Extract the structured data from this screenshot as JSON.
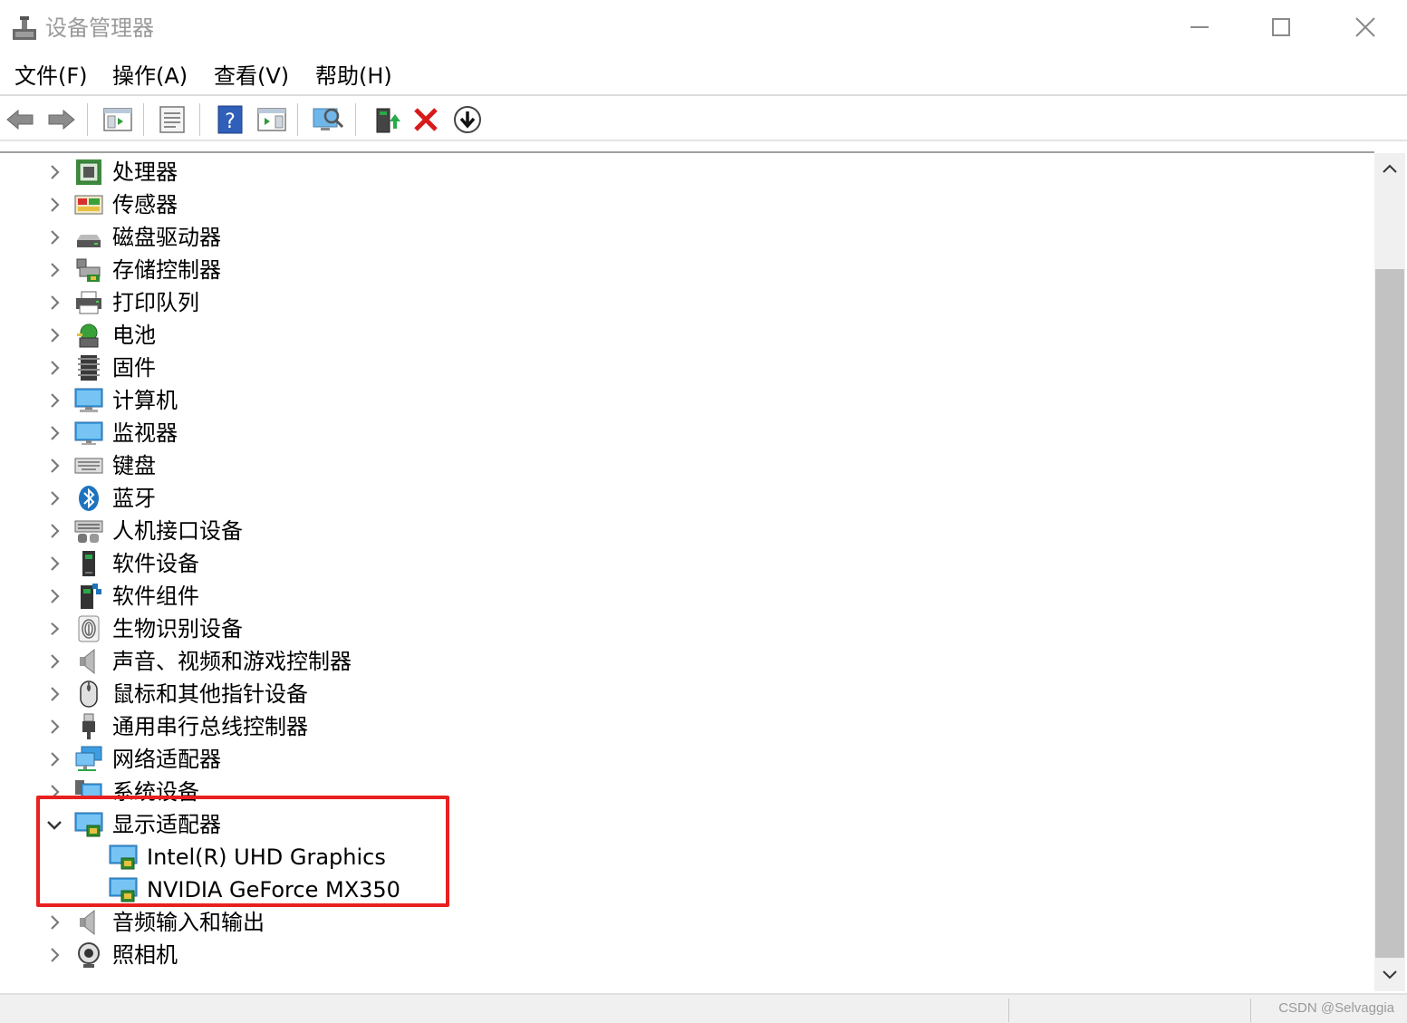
{
  "window": {
    "title": "设备管理器"
  },
  "menu": [
    {
      "label": "文件(F)"
    },
    {
      "label": "操作(A)"
    },
    {
      "label": "查看(V)"
    },
    {
      "label": "帮助(H)"
    }
  ],
  "toolbar": {
    "icons": [
      "back-icon",
      "forward-icon",
      "show-hide-console-tree-icon",
      "properties-icon",
      "help-icon",
      "action-pane-icon",
      "scan-hardware-icon",
      "update-driver-icon",
      "uninstall-device-icon",
      "download-driver-icon"
    ]
  },
  "tree": {
    "items": [
      {
        "label": "处理器",
        "icon": "processor-icon",
        "expanded": false
      },
      {
        "label": "传感器",
        "icon": "sensor-icon",
        "expanded": false
      },
      {
        "label": "磁盘驱动器",
        "icon": "disk-drive-icon",
        "expanded": false
      },
      {
        "label": "存储控制器",
        "icon": "storage-controller-icon",
        "expanded": false
      },
      {
        "label": "打印队列",
        "icon": "printer-icon",
        "expanded": false
      },
      {
        "label": "电池",
        "icon": "battery-icon",
        "expanded": false
      },
      {
        "label": "固件",
        "icon": "firmware-icon",
        "expanded": false
      },
      {
        "label": "计算机",
        "icon": "computer-icon",
        "expanded": false
      },
      {
        "label": "监视器",
        "icon": "monitor-icon",
        "expanded": false
      },
      {
        "label": "键盘",
        "icon": "keyboard-icon",
        "expanded": false
      },
      {
        "label": "蓝牙",
        "icon": "bluetooth-icon",
        "expanded": false
      },
      {
        "label": "人机接口设备",
        "icon": "hid-icon",
        "expanded": false
      },
      {
        "label": "软件设备",
        "icon": "software-device-icon",
        "expanded": false
      },
      {
        "label": "软件组件",
        "icon": "software-component-icon",
        "expanded": false
      },
      {
        "label": "生物识别设备",
        "icon": "biometric-icon",
        "expanded": false
      },
      {
        "label": "声音、视频和游戏控制器",
        "icon": "sound-icon",
        "expanded": false
      },
      {
        "label": "鼠标和其他指针设备",
        "icon": "mouse-icon",
        "expanded": false
      },
      {
        "label": "通用串行总线控制器",
        "icon": "usb-icon",
        "expanded": false
      },
      {
        "label": "网络适配器",
        "icon": "network-adapter-icon",
        "expanded": false
      },
      {
        "label": "系统设备",
        "icon": "system-device-icon",
        "expanded": false
      },
      {
        "label": "显示适配器",
        "icon": "display-adapter-icon",
        "expanded": true,
        "children": [
          {
            "label": "Intel(R) UHD Graphics",
            "icon": "display-adapter-icon"
          },
          {
            "label": "NVIDIA GeForce MX350",
            "icon": "display-adapter-icon"
          }
        ]
      },
      {
        "label": "音频输入和输出",
        "icon": "audio-io-icon",
        "expanded": false
      },
      {
        "label": "照相机",
        "icon": "camera-icon",
        "expanded": false
      }
    ]
  },
  "status": {
    "watermark": "CSDN @Selvaggia"
  },
  "colors": {
    "highlight": "#e8201f",
    "accent_blue": "#1e73be"
  }
}
